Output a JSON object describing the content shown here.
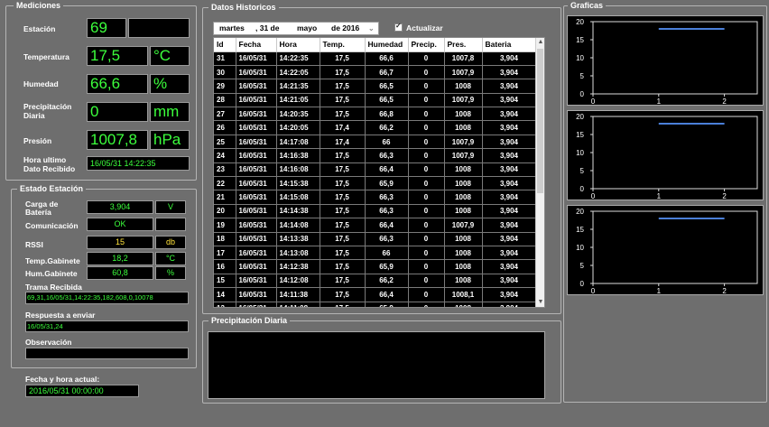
{
  "mediciones": {
    "title": "Mediciones",
    "estacion": {
      "label": "Estación",
      "value": "69"
    },
    "temperatura": {
      "label": "Temperatura",
      "value": "17,5",
      "unit": "°C"
    },
    "humedad": {
      "label": "Humedad",
      "value": "66,6",
      "unit": "%"
    },
    "precipitacion": {
      "label1": "Precipitación",
      "label2": "Diaria",
      "value": "0",
      "unit": "mm"
    },
    "presion": {
      "label": "Presión",
      "value": "1007,8",
      "unit": "hPa"
    },
    "hora": {
      "label1": "Hora ultimo",
      "label2": "Dato Recibido",
      "value": "16/05/31 14:22:35"
    }
  },
  "estado": {
    "title": "Estado Estación",
    "carga": {
      "label1": "Carga de",
      "label2": "Batería",
      "value": "3,904",
      "unit": "V"
    },
    "comunicacion": {
      "label": "Comunicación",
      "value": "OK"
    },
    "rssi": {
      "label": "RSSI",
      "value": "15",
      "unit": "db"
    },
    "temp_gabinete": {
      "label": "Temp.Gabinete",
      "value": "18,2",
      "unit": "°C"
    },
    "hum_gabinete": {
      "label": "Hum.Gabinete",
      "value": "60,8",
      "unit": "%"
    },
    "trama": {
      "label": "Trama Recibida",
      "value": "69,31,16/05/31,14:22:35,182,608,0,10078"
    },
    "respuesta": {
      "label": "Respuesta a enviar",
      "value": "16/05/31,24"
    },
    "observacion": {
      "label": "Observación",
      "value": ""
    }
  },
  "fecha_actual": {
    "label": "Fecha y hora actual:",
    "value": "2016/05/31 00:00:00"
  },
  "historicos": {
    "title": "Datos Historicos",
    "date_day": "martes",
    "date_num": ", 31 de",
    "date_month": "mayo",
    "date_year": "de 2016",
    "actualizar": "Actualizar",
    "columns": [
      "Id",
      "Fecha",
      "Hora",
      "Temp.",
      "Humedad",
      "Precip.",
      "Pres.",
      "Bateria"
    ],
    "rows": [
      [
        "31",
        "16/05/31",
        "14:22:35",
        "17,5",
        "66,6",
        "0",
        "1007,8",
        "3,904"
      ],
      [
        "30",
        "16/05/31",
        "14:22:05",
        "17,5",
        "66,7",
        "0",
        "1007,9",
        "3,904"
      ],
      [
        "29",
        "16/05/31",
        "14:21:35",
        "17,5",
        "66,5",
        "0",
        "1008",
        "3,904"
      ],
      [
        "28",
        "16/05/31",
        "14:21:05",
        "17,5",
        "66,5",
        "0",
        "1007,9",
        "3,904"
      ],
      [
        "27",
        "16/05/31",
        "14:20:35",
        "17,5",
        "66,8",
        "0",
        "1008",
        "3,904"
      ],
      [
        "26",
        "16/05/31",
        "14:20:05",
        "17,4",
        "66,2",
        "0",
        "1008",
        "3,904"
      ],
      [
        "25",
        "16/05/31",
        "14:17:08",
        "17,4",
        "66",
        "0",
        "1007,9",
        "3,904"
      ],
      [
        "24",
        "16/05/31",
        "14:16:38",
        "17,5",
        "66,3",
        "0",
        "1007,9",
        "3,904"
      ],
      [
        "23",
        "16/05/31",
        "14:16:08",
        "17,5",
        "66,4",
        "0",
        "1008",
        "3,904"
      ],
      [
        "22",
        "16/05/31",
        "14:15:38",
        "17,5",
        "65,9",
        "0",
        "1008",
        "3,904"
      ],
      [
        "21",
        "16/05/31",
        "14:15:08",
        "17,5",
        "66,3",
        "0",
        "1008",
        "3,904"
      ],
      [
        "20",
        "16/05/31",
        "14:14:38",
        "17,5",
        "66,3",
        "0",
        "1008",
        "3,904"
      ],
      [
        "19",
        "16/05/31",
        "14:14:08",
        "17,5",
        "66,4",
        "0",
        "1007,9",
        "3,904"
      ],
      [
        "18",
        "16/05/31",
        "14:13:38",
        "17,5",
        "66,3",
        "0",
        "1008",
        "3,904"
      ],
      [
        "17",
        "16/05/31",
        "14:13:08",
        "17,5",
        "66",
        "0",
        "1008",
        "3,904"
      ],
      [
        "16",
        "16/05/31",
        "14:12:38",
        "17,5",
        "65,9",
        "0",
        "1008",
        "3,904"
      ],
      [
        "15",
        "16/05/31",
        "14:12:08",
        "17,5",
        "66,2",
        "0",
        "1008",
        "3,904"
      ],
      [
        "14",
        "16/05/31",
        "14:11:38",
        "17,5",
        "66,4",
        "0",
        "1008,1",
        "3,904"
      ],
      [
        "13",
        "16/05/31",
        "14:11:08",
        "17,5",
        "65,9",
        "0",
        "1008",
        "3,904"
      ]
    ]
  },
  "precipitacion_diaria": {
    "title": "Precipitación Diaria"
  },
  "graficas": {
    "title": "Graficas"
  },
  "chart_data": [
    {
      "type": "line",
      "y_ticks": [
        "20",
        "15",
        "10",
        "5",
        "0"
      ],
      "x_ticks": [
        "0",
        "1",
        "2"
      ],
      "ylim": [
        0,
        20
      ],
      "xlim": [
        0,
        2.5
      ],
      "series": [
        {
          "x": [
            1,
            2
          ],
          "y": [
            18,
            18
          ]
        }
      ]
    },
    {
      "type": "line",
      "y_ticks": [
        "20",
        "15",
        "10",
        "5",
        "0"
      ],
      "x_ticks": [
        "0",
        "1",
        "2"
      ],
      "ylim": [
        0,
        20
      ],
      "xlim": [
        0,
        2.5
      ],
      "series": [
        {
          "x": [
            1,
            2
          ],
          "y": [
            18,
            18
          ]
        }
      ]
    },
    {
      "type": "line",
      "y_ticks": [
        "20",
        "15",
        "10",
        "5",
        "0"
      ],
      "x_ticks": [
        "0",
        "1",
        "2"
      ],
      "ylim": [
        0,
        20
      ],
      "xlim": [
        0,
        2.5
      ],
      "series": [
        {
          "x": [
            1,
            2
          ],
          "y": [
            18,
            18
          ]
        }
      ]
    }
  ],
  "colors": {
    "display_text": "#3cff3c",
    "accent_value": "#ffe23a",
    "chart_line": "#4a7fd8",
    "background": "#6e6e6e"
  }
}
